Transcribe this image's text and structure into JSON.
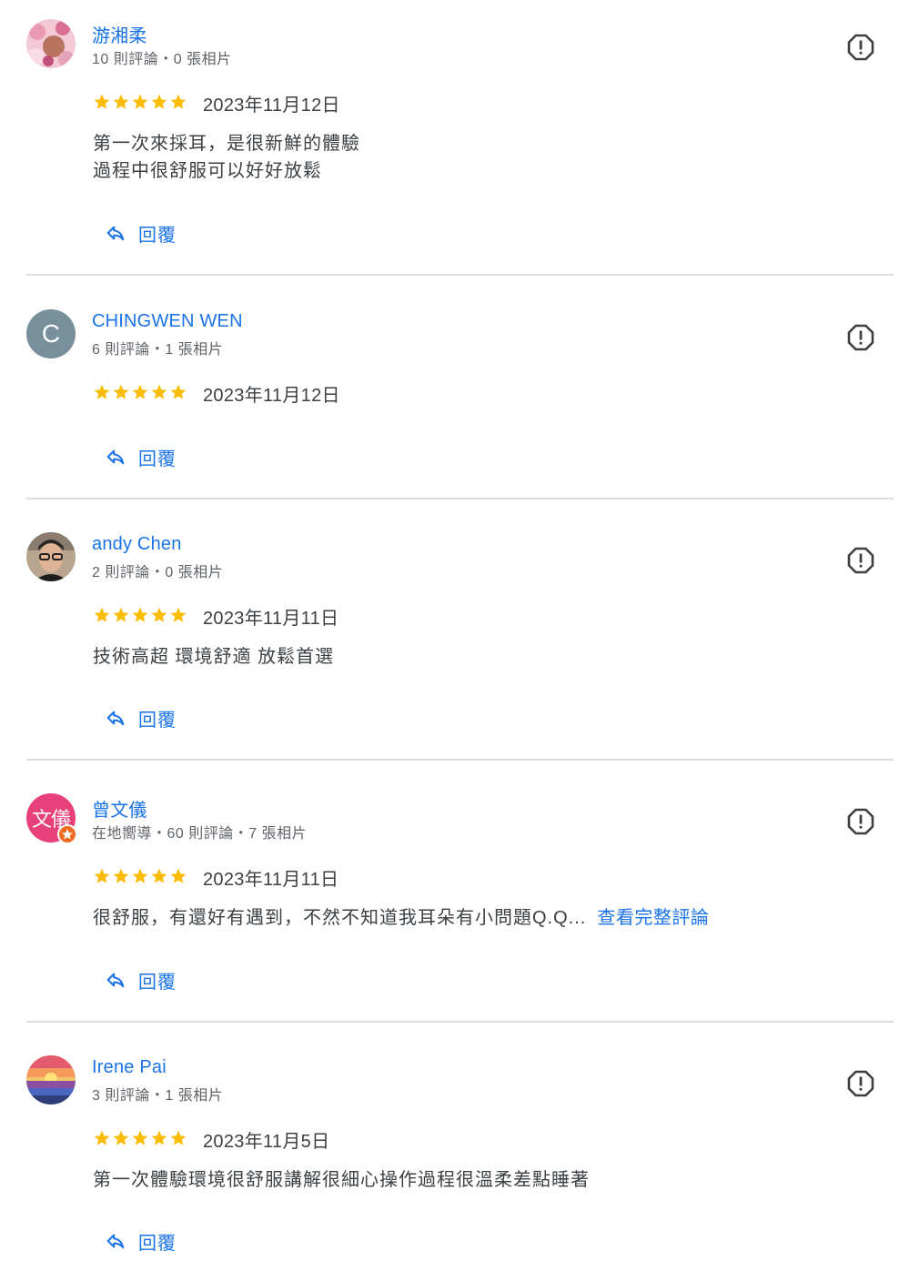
{
  "colors": {
    "link_blue": "#1a73e8",
    "star_gold": "#fbbc04",
    "divider": "#dadce0",
    "text": "#3c4043",
    "meta": "#5f6368"
  },
  "icons": {
    "flag": "report-flag-icon",
    "star": "star-icon",
    "reply": "reply-arrow-icon"
  },
  "reviews": [
    {
      "name": "游湘柔",
      "meta": "10 則評論・0 張相片",
      "rating": 5,
      "date": "2023年11月12日",
      "text": "第一次來採耳，是很新鮮的體驗\n過程中很舒服可以好好放鬆",
      "more": "",
      "reply": "回覆",
      "avatar": {
        "type": "photo",
        "icon": "pink-blossom-photo"
      }
    },
    {
      "name": "CHINGWEN WEN",
      "meta": "6 則評論・1 張相片",
      "rating": 5,
      "date": "2023年11月12日",
      "text": "",
      "more": "",
      "reply": "回覆",
      "avatar": {
        "type": "letter",
        "letter": "C",
        "bg": "#78909c"
      }
    },
    {
      "name": "andy Chen",
      "meta": "2 則評論・0 張相片",
      "rating": 5,
      "date": "2023年11月11日",
      "text": "技術高超 環境舒適 放鬆首選",
      "more": "",
      "reply": "回覆",
      "avatar": {
        "type": "photo",
        "icon": "man-glasses-photo"
      }
    },
    {
      "name": "曾文儀",
      "meta": "在地嚮導・60 則評論・7 張相片",
      "rating": 5,
      "date": "2023年11月11日",
      "text": "很舒服，有還好有遇到，不然不知道我耳朵有小問題Q.Q...",
      "more": "查看完整評論",
      "reply": "回覆",
      "avatar": {
        "type": "letter",
        "letter": "文儀",
        "bg": "#e8407a",
        "badge": "local-guide-star-icon"
      }
    },
    {
      "name": "Irene Pai",
      "meta": "3 則評論・1 張相片",
      "rating": 5,
      "date": "2023年11月5日",
      "text": "第一次體驗環境很舒服講解很細心操作過程很溫柔差點睡著",
      "more": "",
      "reply": "回覆",
      "avatar": {
        "type": "photo",
        "icon": "sunset-painting-photo"
      }
    }
  ]
}
